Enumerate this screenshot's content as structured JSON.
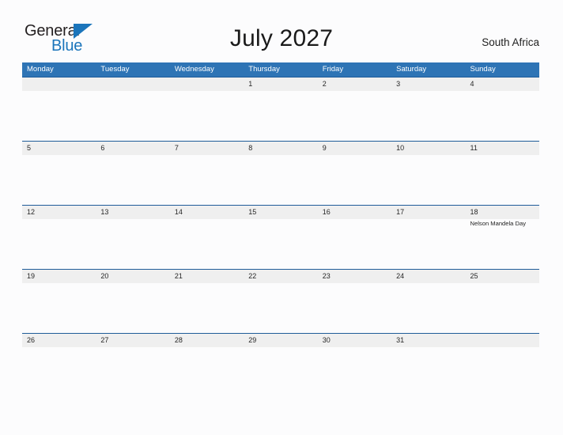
{
  "brand": {
    "word_one": "General",
    "word_two": "Blue",
    "triangle_icon": "triangle-icon",
    "accent_color": "#1b75bb"
  },
  "header": {
    "title": "July 2027",
    "region": "South Africa"
  },
  "theme": {
    "header_blue": "#2e74b5",
    "separator_blue": "#1f5c99",
    "band_grey": "#efefef",
    "page_background": "#fcfcfd"
  },
  "calendar": {
    "weekdays": [
      "Monday",
      "Tuesday",
      "Wednesday",
      "Thursday",
      "Friday",
      "Saturday",
      "Sunday"
    ],
    "weeks": [
      {
        "days": [
          {
            "date": "",
            "event": ""
          },
          {
            "date": "",
            "event": ""
          },
          {
            "date": "",
            "event": ""
          },
          {
            "date": "1",
            "event": ""
          },
          {
            "date": "2",
            "event": ""
          },
          {
            "date": "3",
            "event": ""
          },
          {
            "date": "4",
            "event": ""
          }
        ]
      },
      {
        "days": [
          {
            "date": "5",
            "event": ""
          },
          {
            "date": "6",
            "event": ""
          },
          {
            "date": "7",
            "event": ""
          },
          {
            "date": "8",
            "event": ""
          },
          {
            "date": "9",
            "event": ""
          },
          {
            "date": "10",
            "event": ""
          },
          {
            "date": "11",
            "event": ""
          }
        ]
      },
      {
        "days": [
          {
            "date": "12",
            "event": ""
          },
          {
            "date": "13",
            "event": ""
          },
          {
            "date": "14",
            "event": ""
          },
          {
            "date": "15",
            "event": ""
          },
          {
            "date": "16",
            "event": ""
          },
          {
            "date": "17",
            "event": ""
          },
          {
            "date": "18",
            "event": "Nelson Mandela Day"
          }
        ]
      },
      {
        "days": [
          {
            "date": "19",
            "event": ""
          },
          {
            "date": "20",
            "event": ""
          },
          {
            "date": "21",
            "event": ""
          },
          {
            "date": "22",
            "event": ""
          },
          {
            "date": "23",
            "event": ""
          },
          {
            "date": "24",
            "event": ""
          },
          {
            "date": "25",
            "event": ""
          }
        ]
      },
      {
        "days": [
          {
            "date": "26",
            "event": ""
          },
          {
            "date": "27",
            "event": ""
          },
          {
            "date": "28",
            "event": ""
          },
          {
            "date": "29",
            "event": ""
          },
          {
            "date": "30",
            "event": ""
          },
          {
            "date": "31",
            "event": ""
          },
          {
            "date": "",
            "event": ""
          }
        ]
      }
    ]
  }
}
